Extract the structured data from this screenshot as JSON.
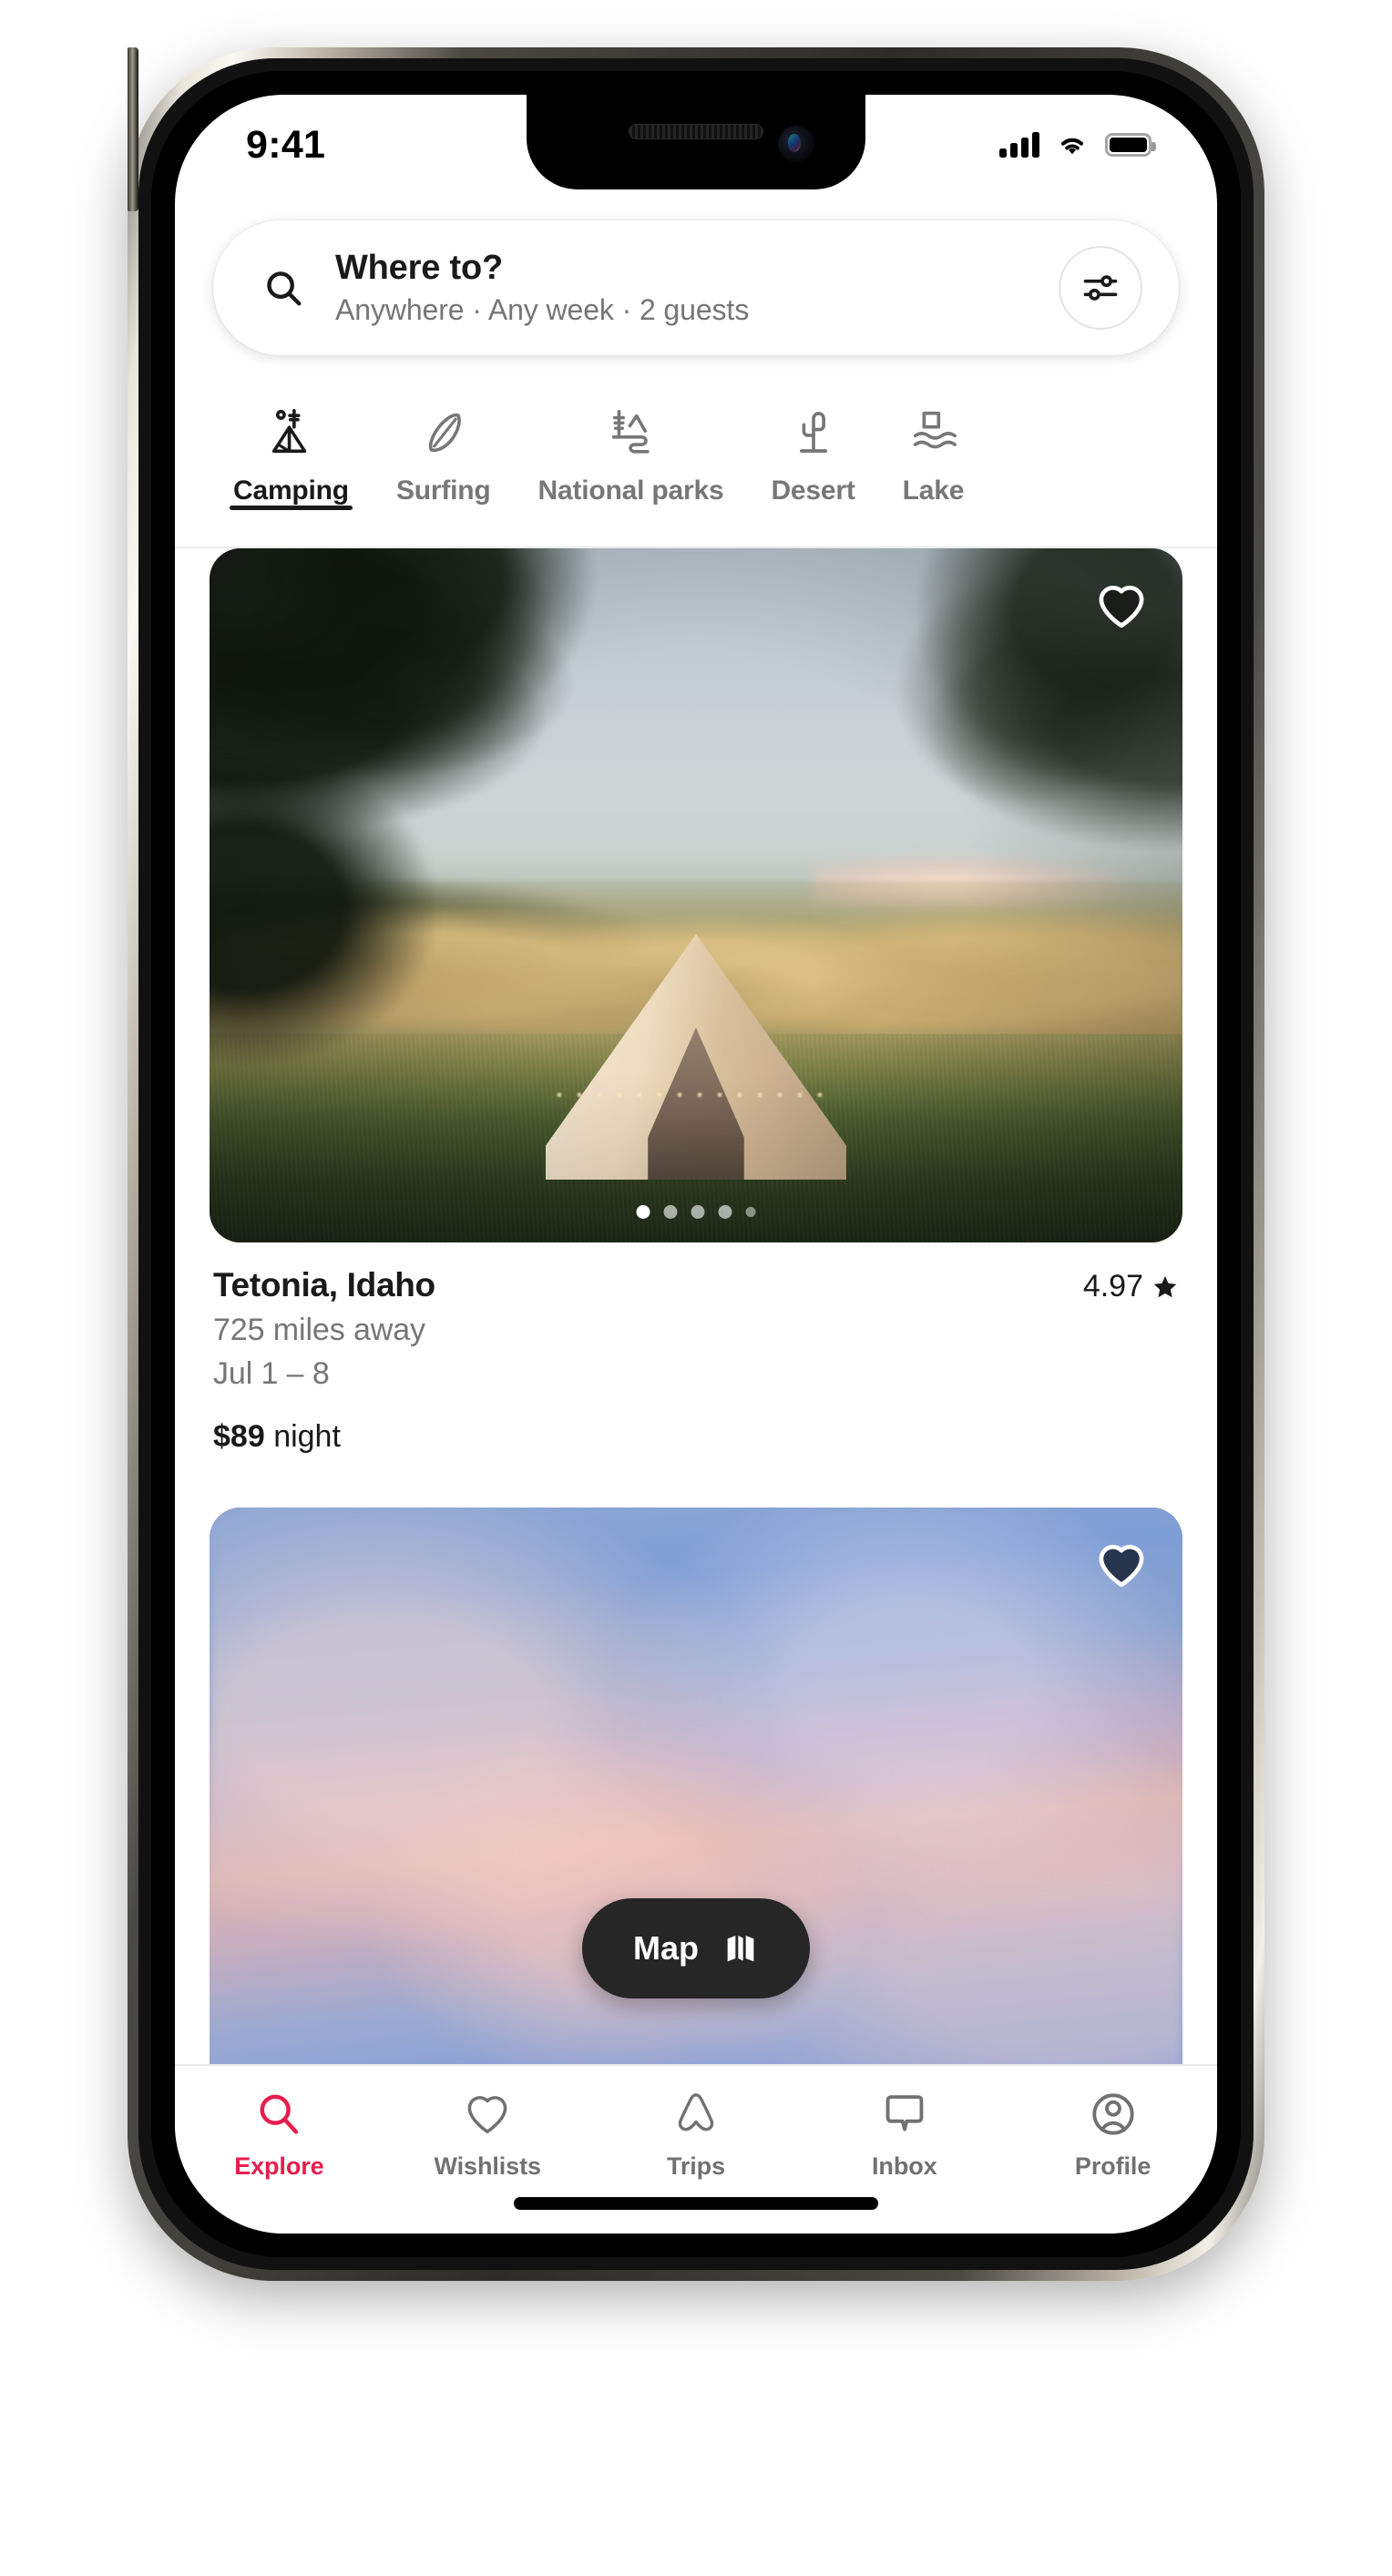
{
  "status": {
    "time": "9:41",
    "cellular_icon": "cellular-signal-icon",
    "wifi_icon": "wifi-icon",
    "battery_icon": "battery-full-icon"
  },
  "search": {
    "icon": "search-icon",
    "title": "Where to?",
    "subtitle": "Anywhere · Any week · 2 guests",
    "filter_icon": "filter-tune-icon"
  },
  "categories": {
    "items": [
      {
        "label": "Camping",
        "icon": "tent-icon",
        "active": true
      },
      {
        "label": "Surfing",
        "icon": "surfboard-icon",
        "active": false
      },
      {
        "label": "National parks",
        "icon": "national-park-icon",
        "active": false
      },
      {
        "label": "Desert",
        "icon": "cactus-icon",
        "active": false
      },
      {
        "label": "Lake",
        "icon": "lake-icon",
        "active": false
      }
    ]
  },
  "listings": [
    {
      "photo_alt": "bell tent in golden wildflower meadow at sunset",
      "favorite_icon": "heart-icon",
      "favorited": false,
      "carousel": {
        "count": 5,
        "active_index": 0
      },
      "title": "Tetonia, Idaho",
      "rating": "4.97",
      "rating_icon": "star-icon",
      "distance": "725 miles away",
      "dates": "Jul 1 – 8",
      "price_amount": "$89",
      "price_unit": "night"
    },
    {
      "photo_alt": "pink and blue sunset clouds",
      "favorite_icon": "heart-icon",
      "favorited": false
    }
  ],
  "map_button": {
    "label": "Map",
    "icon": "map-folded-icon"
  },
  "bottom_nav": {
    "items": [
      {
        "label": "Explore",
        "icon": "search-icon",
        "active": true
      },
      {
        "label": "Wishlists",
        "icon": "heart-icon",
        "active": false
      },
      {
        "label": "Trips",
        "icon": "airbnb-belo-icon",
        "active": false
      },
      {
        "label": "Inbox",
        "icon": "message-icon",
        "active": false
      },
      {
        "label": "Profile",
        "icon": "user-circle-icon",
        "active": false
      }
    ]
  },
  "colors": {
    "accent": "#E61E4D",
    "text_primary": "#1a1a1a",
    "text_secondary": "#767676",
    "map_fab_bg": "#262626",
    "background": "#ffffff"
  }
}
